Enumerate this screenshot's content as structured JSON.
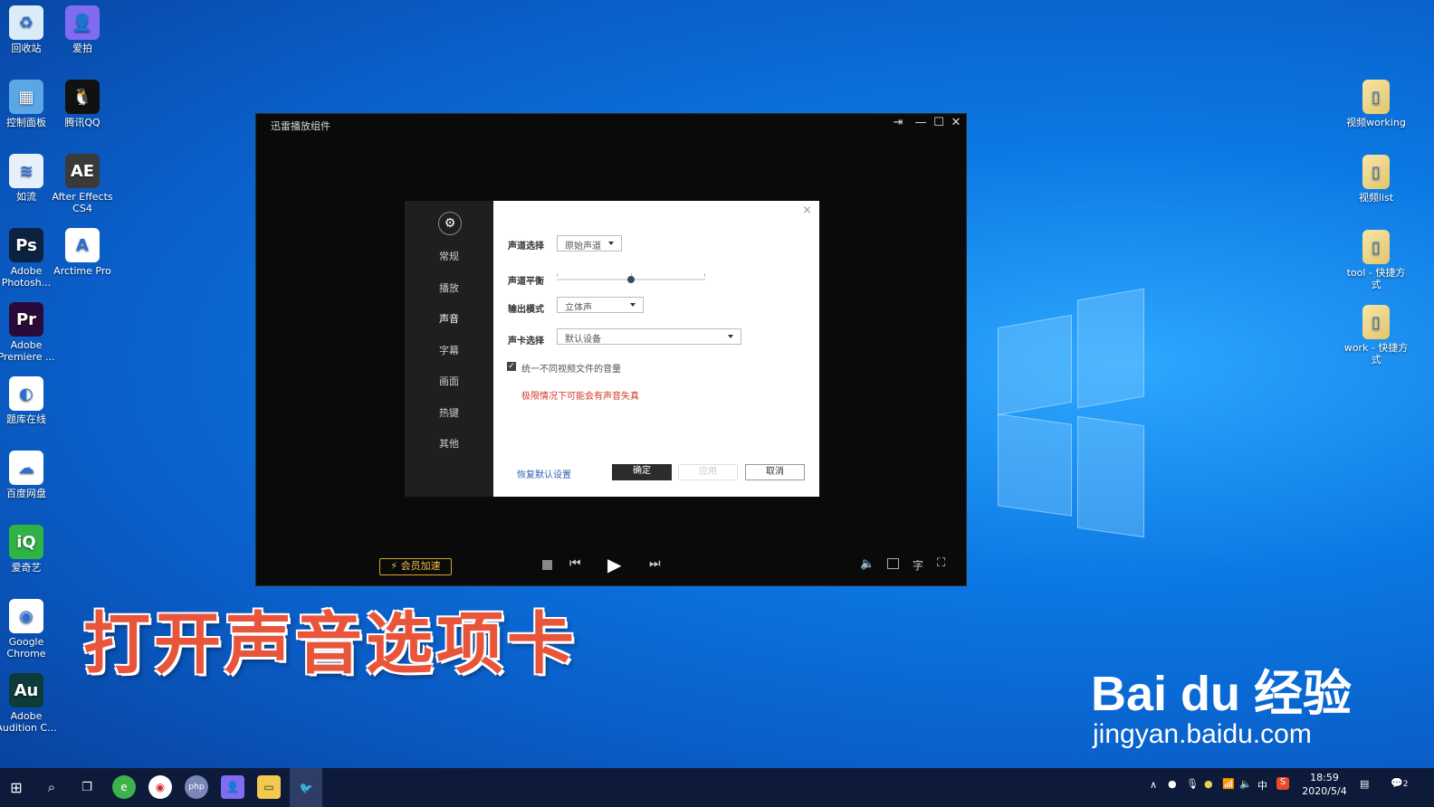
{
  "desktop_left": [
    {
      "label": "回收站",
      "icon": "recycle-bin-icon",
      "color": "#d9ecf7",
      "glyph": "♻"
    },
    {
      "label": "爱拍",
      "icon": "aipai-icon",
      "color": "#7f6cf0",
      "glyph": "👤"
    },
    {
      "label": "控制面板",
      "icon": "control-panel-icon",
      "color": "#5aa7e6",
      "glyph": "▦"
    },
    {
      "label": "腾讯QQ",
      "icon": "qq-icon",
      "color": "#111111",
      "glyph": "🐧"
    },
    {
      "label": "如流",
      "icon": "ruliu-icon",
      "color": "#e8f1fb",
      "glyph": "≋"
    },
    {
      "label": "After Effects CS4",
      "icon": "after-effects-icon",
      "color": "#3a3a3a",
      "glyph": "AE"
    },
    {
      "label": "Adobe Photosh...",
      "icon": "photoshop-icon",
      "color": "#0b2340",
      "glyph": "Ps"
    },
    {
      "label": "Arctime Pro",
      "icon": "arctime-icon",
      "color": "#ffffff",
      "glyph": "A"
    },
    {
      "label": "Adobe Premiere ...",
      "icon": "premiere-icon",
      "color": "#2a0a3a",
      "glyph": "Pr"
    },
    {
      "label": "题库在线",
      "icon": "tiku-icon",
      "color": "#ffffff",
      "glyph": "◐"
    },
    {
      "label": "百度网盘",
      "icon": "baidu-netdisk-icon",
      "color": "#ffffff",
      "glyph": "☁"
    },
    {
      "label": "爱奇艺",
      "icon": "iqiyi-icon",
      "color": "#2fb344",
      "glyph": "iQ"
    },
    {
      "label": "Google Chrome",
      "icon": "chrome-icon",
      "color": "#ffffff",
      "glyph": "◉"
    },
    {
      "label": "Adobe Audition C...",
      "icon": "audition-icon",
      "color": "#0c3b3a",
      "glyph": "Au"
    }
  ],
  "desktop_right": [
    {
      "label": "视频working",
      "icon": "folder-shortcut-icon"
    },
    {
      "label": "视频list",
      "icon": "folder-shortcut-icon"
    },
    {
      "label": "tool - 快捷方式",
      "icon": "folder-shortcut-icon"
    },
    {
      "label": "work - 快捷方式",
      "icon": "folder-shortcut-icon"
    }
  ],
  "player": {
    "title": "迅雷播放组件",
    "pin_glyph": "⇥",
    "min_glyph": "—",
    "max_glyph": "☐",
    "close_glyph": "✕",
    "vip_label": "⚡ 会员加速"
  },
  "settings": {
    "nav": [
      "常规",
      "播放",
      "声音",
      "字幕",
      "画面",
      "热键",
      "其他"
    ],
    "active_nav": "声音",
    "close_glyph": "×",
    "channel_label": "声道选择",
    "channel_value": "原始声道",
    "balance_label": "声道平衡",
    "balance_level": 0.5,
    "output_label": "输出模式",
    "output_value": "立体声",
    "card_label": "声卡选择",
    "card_value": "默认设备",
    "checkbox_label": "统一不同视频文件的音量",
    "checkbox_checked": true,
    "warning": "极限情况下可能会有声音失真",
    "restore_label": "恢复默认设置",
    "ok_label": "确定",
    "apply_label": "应用",
    "cancel_label": "取消"
  },
  "caption": "打开声音选项卡",
  "watermark": {
    "brand": "Bai du 经验",
    "url": "jingyan.baidu.com"
  },
  "taskbar": {
    "time": "18:59",
    "date": "2020/5/4",
    "ime": "中",
    "notification_count": "2"
  }
}
